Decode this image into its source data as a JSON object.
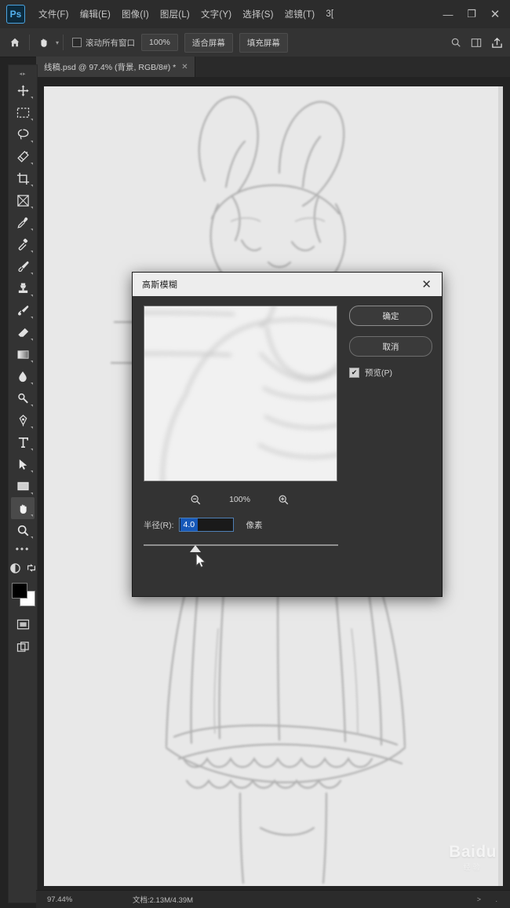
{
  "app": {
    "logo_text": "Ps",
    "menus": [
      {
        "label": "文件(F)"
      },
      {
        "label": "编辑(E)"
      },
      {
        "label": "图像(I)"
      },
      {
        "label": "图层(L)"
      },
      {
        "label": "文字(Y)"
      },
      {
        "label": "选择(S)"
      },
      {
        "label": "滤镜(T)"
      },
      {
        "label": "3["
      }
    ],
    "window_controls": {
      "minimize": "—",
      "maximize": "❐",
      "close": "✕"
    }
  },
  "options_bar": {
    "home_icon": "home-icon",
    "tool_icon": "hand-icon",
    "tool_caret": "▾",
    "scroll_all_windows_label": "滚动所有窗口",
    "zoom_value": "100%",
    "fit_screen_label": "适合屏幕",
    "fill_screen_label": "填充屏幕",
    "search_icon": "search-icon",
    "panel_icon": "panel-icon",
    "share_icon": "share-icon"
  },
  "document_tab": {
    "label": "线稿.psd @ 97.4% (背景, RGB/8#) *",
    "close": "✕"
  },
  "toolbar": {
    "grip": "◂▸",
    "tools": [
      {
        "name": "move-tool",
        "icon": "move-icon",
        "active": false
      },
      {
        "name": "marquee-tool",
        "icon": "rect-marquee-icon",
        "active": false
      },
      {
        "name": "lasso-tool",
        "icon": "lasso-icon",
        "active": false
      },
      {
        "name": "quick-select-tool",
        "icon": "quick-select-icon",
        "active": false
      },
      {
        "name": "crop-tool",
        "icon": "crop-icon",
        "active": false
      },
      {
        "name": "frame-tool",
        "icon": "frame-icon",
        "active": false
      },
      {
        "name": "eyedropper-tool",
        "icon": "eyedropper-icon",
        "active": false
      },
      {
        "name": "healing-brush-tool",
        "icon": "healing-brush-icon",
        "active": false
      },
      {
        "name": "brush-tool",
        "icon": "brush-icon",
        "active": false
      },
      {
        "name": "clone-stamp-tool",
        "icon": "clone-stamp-icon",
        "active": false
      },
      {
        "name": "history-brush-tool",
        "icon": "history-brush-icon",
        "active": false
      },
      {
        "name": "eraser-tool",
        "icon": "eraser-icon",
        "active": false
      },
      {
        "name": "gradient-tool",
        "icon": "gradient-icon",
        "active": false
      },
      {
        "name": "blur-tool",
        "icon": "blur-drop-icon",
        "active": false
      },
      {
        "name": "dodge-tool",
        "icon": "dodge-icon",
        "active": false
      },
      {
        "name": "pen-tool",
        "icon": "pen-icon",
        "active": false
      },
      {
        "name": "type-tool",
        "icon": "type-T-icon",
        "active": false
      },
      {
        "name": "path-selection-tool",
        "icon": "path-arrow-icon",
        "active": false
      },
      {
        "name": "shape-tool",
        "icon": "rectangle-icon",
        "active": false
      },
      {
        "name": "hand-tool",
        "icon": "hand-icon",
        "active": true
      },
      {
        "name": "zoom-tool",
        "icon": "magnifier-icon",
        "active": false
      }
    ],
    "more_tools": "•••",
    "quickmask_icon": "quick-mask-icon",
    "swap_icon": "swap-colors-icon",
    "foreground_color": "#000000",
    "background_color": "#ffffff",
    "screen_mode_icon": "screen-mode-icon",
    "extras_icon": "screen-mode-2-icon"
  },
  "canvas": {
    "watermark": "Baidu",
    "watermark_sub": "经验"
  },
  "status_bar": {
    "zoom": "97.44%",
    "doc_info": "文档:2.13M/4.39M",
    "arrows": "> ."
  },
  "dialog": {
    "title": "高斯模糊",
    "close": "✕",
    "ok_label": "确定",
    "cancel_label": "取消",
    "preview_checkbox_label": "预览(P)",
    "preview_checked": true,
    "preview_check_glyph": "✔",
    "zoom_out_icon": "zoom-out-icon",
    "zoom_in_icon": "zoom-in-icon",
    "zoom_percent": "100%",
    "radius_label": "半径(R):",
    "radius_value": "4.0",
    "radius_unit": "像素",
    "slider_position_percent": 24
  }
}
